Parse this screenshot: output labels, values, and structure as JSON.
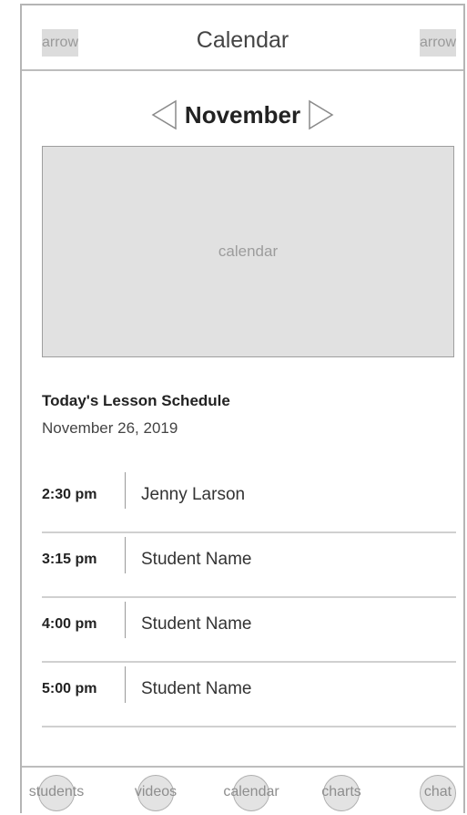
{
  "header": {
    "title": "Calendar",
    "left_arrow_label": "arrow",
    "right_arrow_label": "arrow"
  },
  "month_nav": {
    "month": "November",
    "prev_icon": "triangle-left-icon",
    "next_icon": "triangle-right-icon"
  },
  "calendar_placeholder": "calendar",
  "schedule": {
    "title": "Today's Lesson Schedule",
    "date": "November 26, 2019",
    "rows": [
      {
        "time": "2:30 pm",
        "name": "Jenny Larson"
      },
      {
        "time": "3:15 pm",
        "name": "Student Name"
      },
      {
        "time": "4:00 pm",
        "name": "Student Name"
      },
      {
        "time": "5:00 pm",
        "name": "Student Name"
      }
    ]
  },
  "tabs": [
    {
      "label": "students"
    },
    {
      "label": "videos"
    },
    {
      "label": "calendar"
    },
    {
      "label": "charts"
    },
    {
      "label": "chat"
    }
  ],
  "colors": {
    "placeholder_fill": "#e1e1e1",
    "border": "#bdbdbd",
    "text_dark": "#222222",
    "text_muted": "#9c9c9c"
  }
}
